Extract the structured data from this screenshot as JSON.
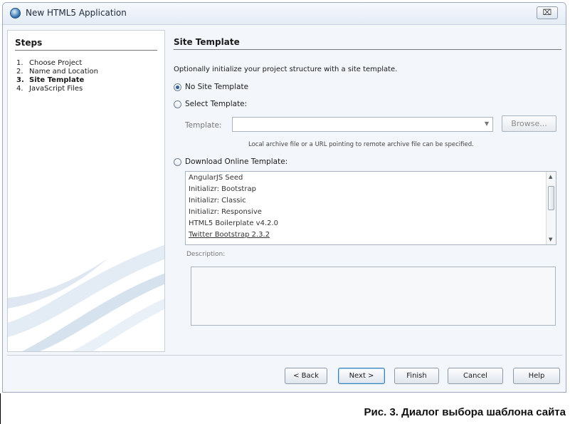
{
  "window": {
    "title": "New HTML5 Application",
    "close_glyph": "⌧",
    "icon": "globe-app-icon"
  },
  "steps": {
    "heading": "Steps",
    "items": [
      {
        "num": "1.",
        "label": "Choose Project",
        "active": false
      },
      {
        "num": "2.",
        "label": "Name and Location",
        "active": false
      },
      {
        "num": "3.",
        "label": "Site Template",
        "active": true
      },
      {
        "num": "4.",
        "label": "JavaScript Files",
        "active": false
      }
    ]
  },
  "panel": {
    "title": "Site Template",
    "intro": "Optionally initialize your project structure with a site template.",
    "option_none": "No Site Template",
    "option_select": "Select Template:",
    "template_label": "Template:",
    "template_value": "",
    "browse_label": "Browse...",
    "hint": "Local archive file or a URL pointing to remote archive file can be specified.",
    "option_online": "Download Online Template:",
    "selected_option": "none",
    "online_templates": [
      "AngularJS Seed",
      "Initializr: Bootstrap",
      "Initializr: Classic",
      "Initializr: Responsive",
      "HTML5 Boilerplate v4.2.0",
      "Twitter Bootstrap 2.3.2"
    ],
    "description_label": "Description:",
    "description_value": ""
  },
  "buttons": {
    "back": "< Back",
    "next": "Next >",
    "finish": "Finish",
    "cancel": "Cancel",
    "help": "Help"
  },
  "caption": "Рис. 3. Диалог выбора шаблона сайта"
}
